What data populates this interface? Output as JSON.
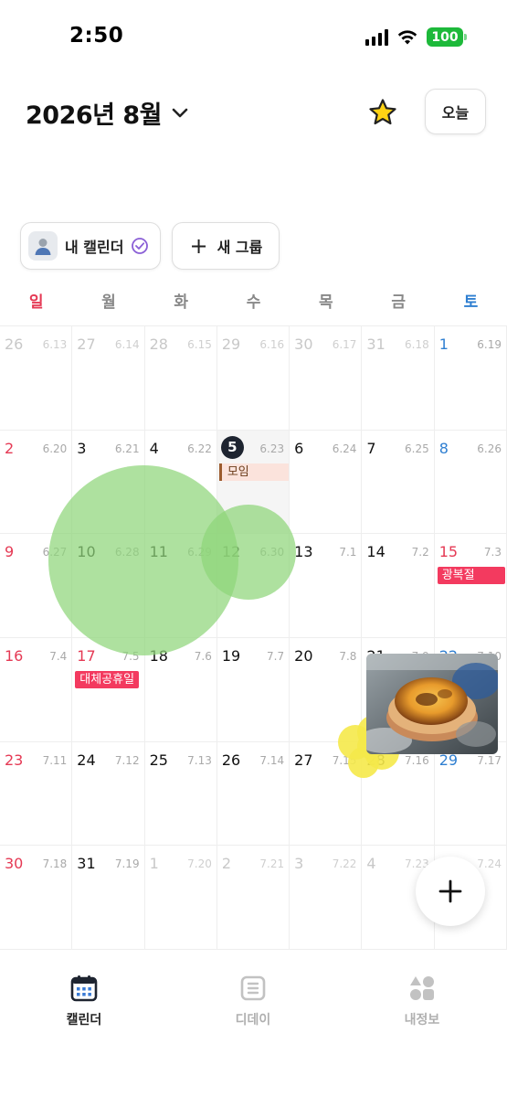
{
  "status_bar": {
    "time": "2:50",
    "battery": "100"
  },
  "header": {
    "title": "2026년 8월",
    "today_label": "오늘"
  },
  "groups": {
    "my_calendar": "내 캘린더",
    "new_group": "새 그룹"
  },
  "weekdays": [
    "일",
    "월",
    "화",
    "수",
    "목",
    "금",
    "토"
  ],
  "calendar": {
    "weeks": [
      [
        {
          "day": "26",
          "lunar": "6.13",
          "other": true
        },
        {
          "day": "27",
          "lunar": "6.14",
          "other": true
        },
        {
          "day": "28",
          "lunar": "6.15",
          "other": true
        },
        {
          "day": "29",
          "lunar": "6.16",
          "other": true
        },
        {
          "day": "30",
          "lunar": "6.17",
          "other": true
        },
        {
          "day": "31",
          "lunar": "6.18",
          "other": true
        },
        {
          "day": "1",
          "lunar": "6.19",
          "other": false
        }
      ],
      [
        {
          "day": "2",
          "lunar": "6.20",
          "other": false
        },
        {
          "day": "3",
          "lunar": "6.21",
          "other": false
        },
        {
          "day": "4",
          "lunar": "6.22",
          "other": false
        },
        {
          "day": "5",
          "lunar": "6.23",
          "other": false,
          "today": true,
          "event": "모임"
        },
        {
          "day": "6",
          "lunar": "6.24",
          "other": false
        },
        {
          "day": "7",
          "lunar": "6.25",
          "other": false
        },
        {
          "day": "8",
          "lunar": "6.26",
          "other": false
        }
      ],
      [
        {
          "day": "9",
          "lunar": "6.27",
          "other": false
        },
        {
          "day": "10",
          "lunar": "6.28",
          "other": false
        },
        {
          "day": "11",
          "lunar": "6.29",
          "other": false
        },
        {
          "day": "12",
          "lunar": "6.30",
          "other": false
        },
        {
          "day": "13",
          "lunar": "7.1",
          "other": false
        },
        {
          "day": "14",
          "lunar": "7.2",
          "other": false
        },
        {
          "day": "15",
          "lunar": "7.3",
          "other": false,
          "holiday": "광복절"
        }
      ],
      [
        {
          "day": "16",
          "lunar": "7.4",
          "other": false
        },
        {
          "day": "17",
          "lunar": "7.5",
          "other": false,
          "holiday": "대체공휴일"
        },
        {
          "day": "18",
          "lunar": "7.6",
          "other": false
        },
        {
          "day": "19",
          "lunar": "7.7",
          "other": false
        },
        {
          "day": "20",
          "lunar": "7.8",
          "other": false
        },
        {
          "day": "21",
          "lunar": "7.9",
          "other": false
        },
        {
          "day": "22",
          "lunar": "7.10",
          "other": false
        }
      ],
      [
        {
          "day": "23",
          "lunar": "7.11",
          "other": false
        },
        {
          "day": "24",
          "lunar": "7.12",
          "other": false
        },
        {
          "day": "25",
          "lunar": "7.13",
          "other": false
        },
        {
          "day": "26",
          "lunar": "7.14",
          "other": false
        },
        {
          "day": "27",
          "lunar": "7.15",
          "other": false
        },
        {
          "day": "28",
          "lunar": "7.16",
          "other": false
        },
        {
          "day": "29",
          "lunar": "7.17",
          "other": false
        }
      ],
      [
        {
          "day": "30",
          "lunar": "7.18",
          "other": false
        },
        {
          "day": "31",
          "lunar": "7.19",
          "other": false
        },
        {
          "day": "1",
          "lunar": "7.20",
          "other": true
        },
        {
          "day": "2",
          "lunar": "7.21",
          "other": true
        },
        {
          "day": "3",
          "lunar": "7.22",
          "other": true
        },
        {
          "day": "4",
          "lunar": "7.23",
          "other": true
        },
        {
          "day": "5",
          "lunar": "7.24",
          "other": true
        }
      ]
    ]
  },
  "colors": {
    "sunday": "#e53954",
    "saturday": "#2f7fd1",
    "holiday": "#f33a5f",
    "today": "#1e2430",
    "sticker_green": "#8fd67a",
    "sticker_yellow": "#f5e94a"
  },
  "tabbar": {
    "calendar": "캘린더",
    "dday": "디데이",
    "my_info": "내정보"
  }
}
